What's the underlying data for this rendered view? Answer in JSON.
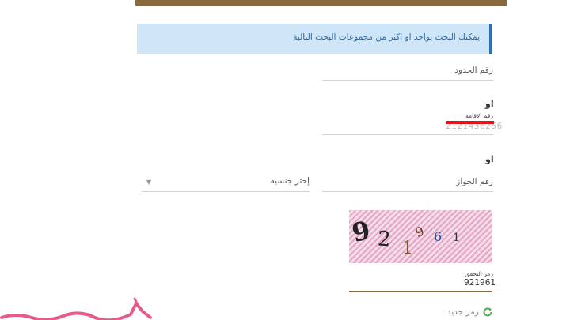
{
  "info": {
    "text": "يمكنك البحث بواحد او اكثر من مجموعات البحث التالية"
  },
  "fields": {
    "border_number_label": "رقم الحدود",
    "or_label": "او",
    "iqama_label": "رقم الإقامة",
    "iqama_value": "2121436256",
    "passport_label": "رقم الجواز",
    "nationality_select": "إختر جنسية"
  },
  "captcha": {
    "digits": [
      "9",
      "2",
      "1",
      "9",
      "6",
      "1"
    ],
    "label": "رمز التحقق",
    "value": "921961",
    "new_code_label": "رمز جديد"
  },
  "colors": {
    "banner": "#8a6a3c",
    "info_bg": "#cfe6f8",
    "info_text": "#2b6aa8",
    "accent_red": "#e0161c",
    "refresh_green": "#4caf50"
  }
}
